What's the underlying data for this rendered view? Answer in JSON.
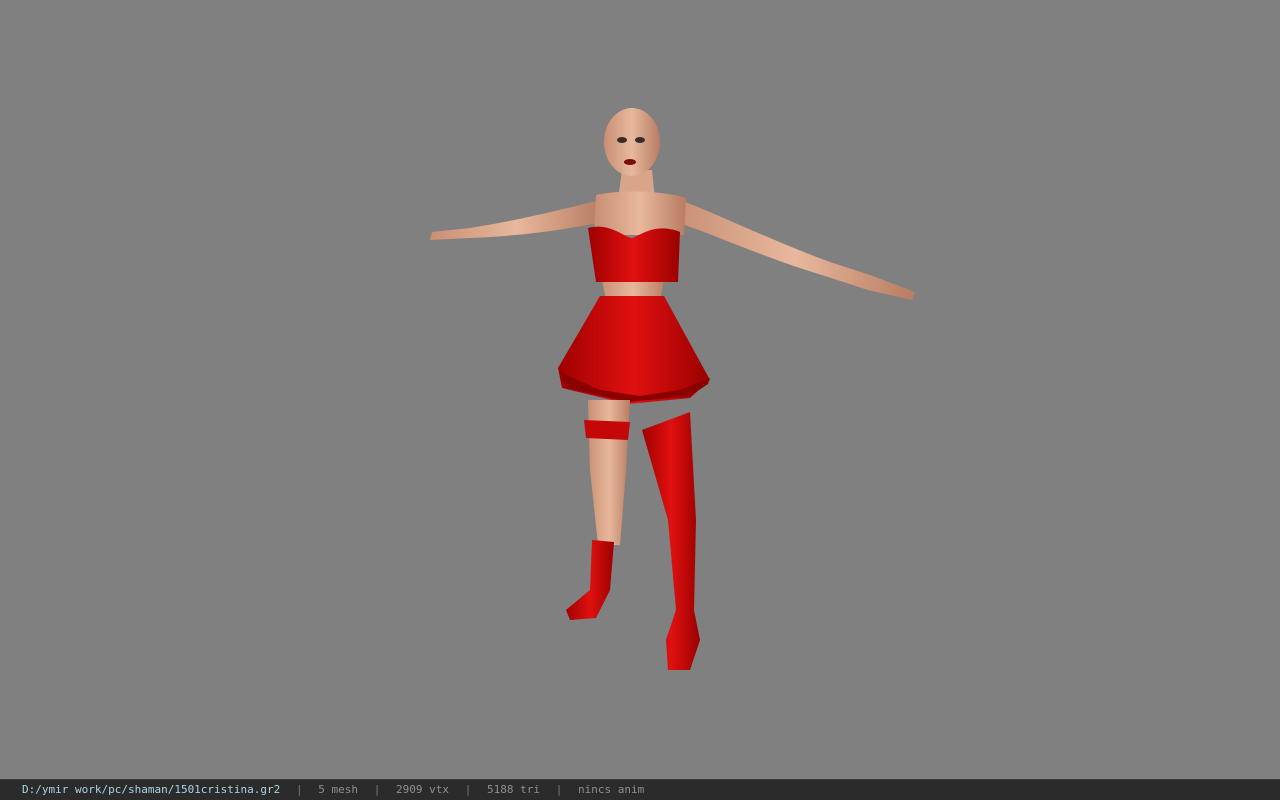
{
  "viewport": {
    "background": "#808080",
    "model_description": "3D character model in T-pose wearing red top, red skirt and red stockings"
  },
  "status": {
    "file_path": "D:/ymir work/pc/shaman/1501cristina.gr2",
    "mesh_count": "5 mesh",
    "vertex_count": "2909 vtx",
    "triangle_count": "5188 tri",
    "animation": "nincs anim",
    "separator": "|"
  },
  "colors": {
    "outfit_red": "#d10a0a",
    "skin": "#d9a58a",
    "statusbar_bg": "#2b2b2b",
    "path_text": "#a9d3e6"
  }
}
